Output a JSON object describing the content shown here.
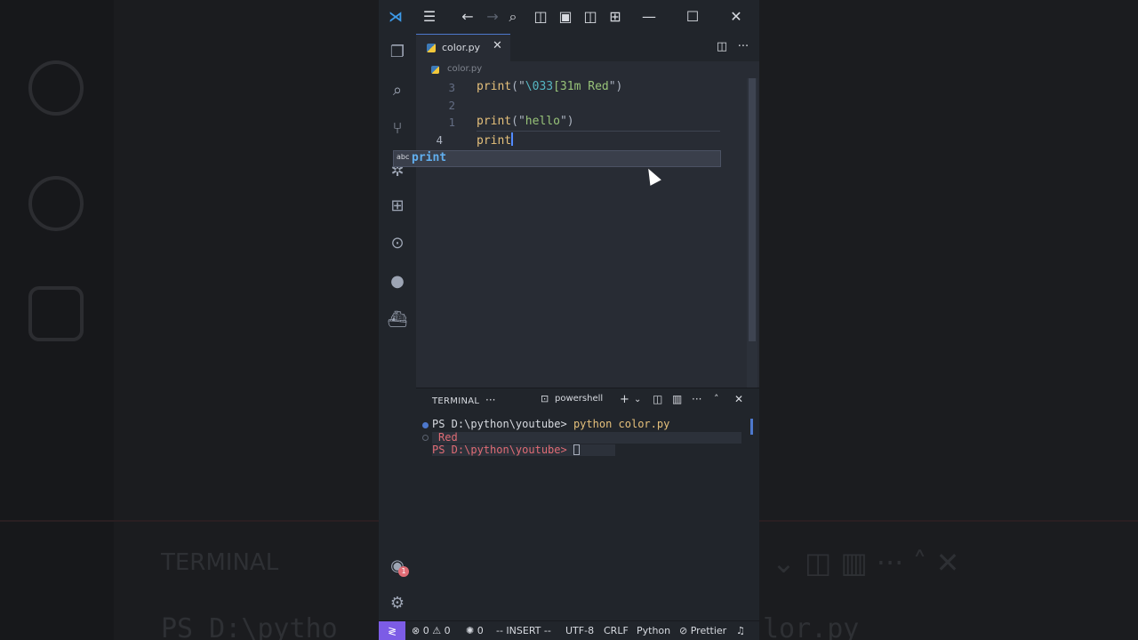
{
  "background": {
    "terminal_label": "TERMINAL",
    "prompt_fragment": "PS D:\\pytho",
    "command_fragment": "lor.py"
  },
  "window": {
    "title_icons": [
      "vscode-logo",
      "menu-icon",
      "back-arrow-icon",
      "forward-arrow-icon",
      "search-icon",
      "toggle-sidebar-icon",
      "toggle-panel-icon",
      "toggle-secondary-sidebar-icon",
      "customize-layout-icon",
      "minimize-icon",
      "maximize-icon",
      "close-icon"
    ]
  },
  "tab": {
    "label": "color.py",
    "close": "✕"
  },
  "breadcrumb": "color.py",
  "editor": {
    "lines": [
      {
        "number": "3",
        "code_fn": "print",
        "code_open": "(\"",
        "code_esc": "\\033",
        "code_str": "[31m Red",
        "code_close": "\")"
      },
      {
        "number": "2"
      },
      {
        "number": "1",
        "code_fn": "print",
        "code_open": "(\"",
        "code_str": "hello",
        "code_close": "\")"
      },
      {
        "number": "4",
        "code_fn": "print"
      }
    ]
  },
  "suggestion": {
    "kind": "abc",
    "label": "print"
  },
  "panel": {
    "title": "TERMINAL",
    "more": "···",
    "shell": "powershell",
    "lines": [
      {
        "prompt": "PS D:\\python\\youtube> ",
        "command": "python color.py"
      },
      {
        "output": "Red"
      },
      {
        "prompt": "PS D:\\python\\youtube> "
      }
    ]
  },
  "status": {
    "errors": "0",
    "warnings": "0",
    "ports": "0",
    "mode": "-- INSERT --",
    "encoding": "UTF-8",
    "eol": "CRLF",
    "language": "Python",
    "formatter": "Prettier"
  },
  "accounts_badge": "1",
  "colors": {
    "accent": "#4d78cc",
    "remote": "#7c5ce6",
    "terminal_red": "#e06c75",
    "prompt_yellow": "#e5c07b",
    "string_green": "#98c379"
  }
}
